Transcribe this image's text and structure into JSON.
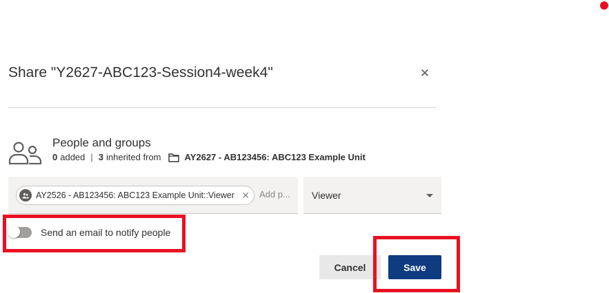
{
  "dialog": {
    "title": "Share \"Y2627-ABC123-Session4-week4\"",
    "close_symbol": "✕"
  },
  "people_section": {
    "title": "People and groups",
    "added_count": "0",
    "added_label": "added",
    "separator": "|",
    "inherited_count": "3",
    "inherited_label": "inherited from",
    "inherited_source": "AY2627 - AB123456: ABC123 Example Unit",
    "icon": "people-icon",
    "source_icon": "folder-icon"
  },
  "people_input": {
    "chip_label": "AY2526 - AB123456: ABC123 Example Unit::Viewer",
    "chip_remove_symbol": "✕",
    "chip_icon": "group-icon",
    "placeholder": "Add p..."
  },
  "role_dropdown": {
    "selected": "Viewer"
  },
  "notify": {
    "label": "Send an email to notify people",
    "enabled": false
  },
  "actions": {
    "cancel_label": "Cancel",
    "save_label": "Save"
  },
  "colors": {
    "highlight": "#e81123",
    "primary_button": "#0f3c80",
    "field_background": "#f3f2f1"
  }
}
